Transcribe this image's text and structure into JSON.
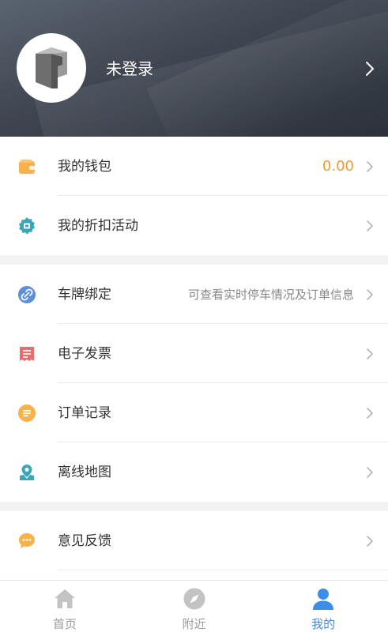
{
  "header": {
    "username": "未登录"
  },
  "section1": {
    "wallet": {
      "label": "我的钱包",
      "value": "0.00",
      "icon": "wallet-icon"
    },
    "discount": {
      "label": "我的折扣活动",
      "icon": "discount-badge-icon"
    }
  },
  "section2": {
    "plate": {
      "label": "车牌绑定",
      "value": "可查看实时停车情况及订单信息",
      "icon": "link-icon"
    },
    "invoice": {
      "label": "电子发票",
      "icon": "receipt-icon"
    },
    "orders": {
      "label": "订单记录",
      "icon": "order-list-icon"
    },
    "offline_map": {
      "label": "离线地图",
      "icon": "map-pin-icon"
    }
  },
  "section3": {
    "feedback": {
      "label": "意见反馈",
      "icon": "chat-bubble-icon"
    }
  },
  "tabbar": {
    "home": "首页",
    "nearby": "附近",
    "mine": "我的"
  },
  "colors": {
    "accent_blue": "#3d8ee8",
    "wallet_orange": "#f39a2c"
  }
}
